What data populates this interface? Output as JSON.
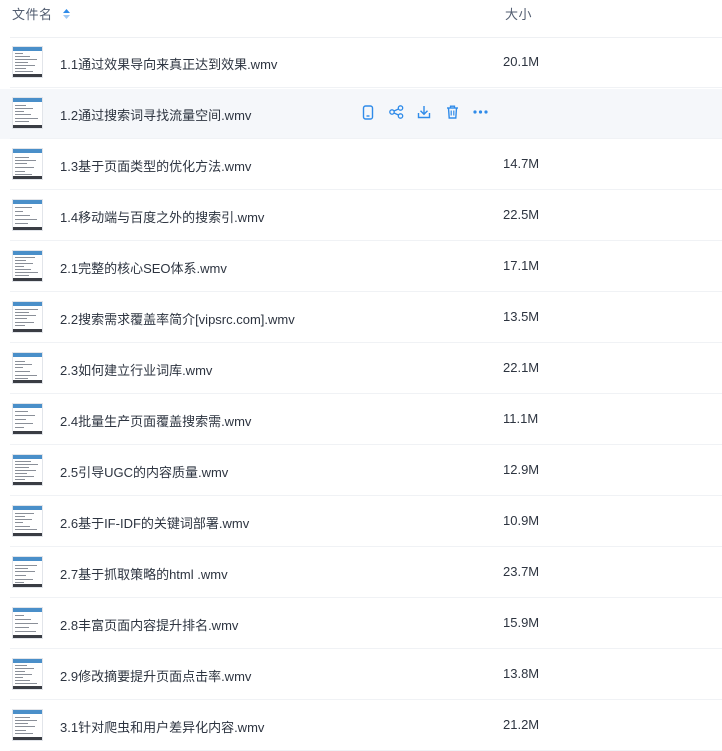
{
  "header": {
    "name_label": "文件名",
    "size_label": "大小",
    "sort_icon": "sort-icon"
  },
  "files": [
    {
      "name": "1.1通过效果导向来真正达到效果.wmv",
      "size": "20.1M"
    },
    {
      "name": "1.2通过搜索词寻找流量空间.wmv",
      "size": ""
    },
    {
      "name": "1.3基于页面类型的优化方法.wmv",
      "size": "14.7M"
    },
    {
      "name": "1.4移动端与百度之外的搜索引.wmv",
      "size": "22.5M"
    },
    {
      "name": "2.1完整的核心SEO体系.wmv",
      "size": "17.1M"
    },
    {
      "name": "2.2搜索需求覆盖率简介[vipsrc.com].wmv",
      "size": "13.5M"
    },
    {
      "name": "2.3如何建立行业词库.wmv",
      "size": "22.1M"
    },
    {
      "name": "2.4批量生产页面覆盖搜索需.wmv",
      "size": "11.1M"
    },
    {
      "name": "2.5引导UGC的内容质量.wmv",
      "size": "12.9M"
    },
    {
      "name": "2.6基于IF-IDF的关键词部署.wmv",
      "size": "10.9M"
    },
    {
      "name": "2.7基于抓取策略的html .wmv",
      "size": "23.7M"
    },
    {
      "name": "2.8丰富页面内容提升排名.wmv",
      "size": "15.9M"
    },
    {
      "name": "2.9修改摘要提升页面点击率.wmv",
      "size": "13.8M"
    },
    {
      "name": "3.1针对爬虫和用户差异化内容.wmv",
      "size": "21.2M"
    }
  ],
  "hover_row_index": 1,
  "hover_actions": [
    "phone-icon",
    "share-icon",
    "download-icon",
    "trash-icon",
    "more-icon"
  ],
  "colors": {
    "accent": "#2f8be9",
    "text": "#2d3440",
    "header_text": "#525d70",
    "hover_bg": "#f5f7fa"
  }
}
